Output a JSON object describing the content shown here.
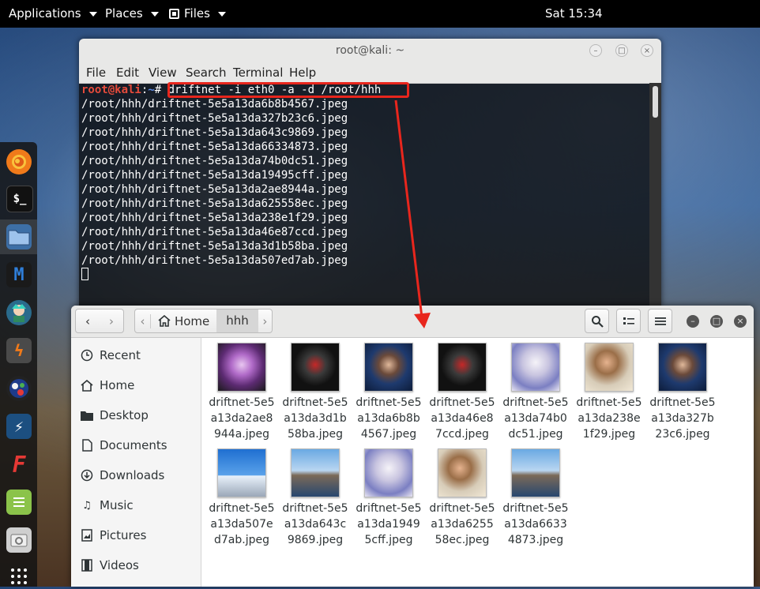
{
  "topbar": {
    "applications": "Applications",
    "places": "Places",
    "files": "Files",
    "clock": "Sat 15:34"
  },
  "terminal": {
    "title": "root@kali: ~",
    "menu": [
      "File",
      "Edit",
      "View",
      "Search",
      "Terminal",
      "Help"
    ],
    "prompt_user": "root@kali",
    "prompt_sep": ":",
    "prompt_path": "~",
    "prompt_symbol": "# ",
    "command": "driftnet -i eth0 -a -d /root/hhh",
    "output": [
      "/root/hhh/driftnet-5e5a13da6b8b4567.jpeg",
      "/root/hhh/driftnet-5e5a13da327b23c6.jpeg",
      "/root/hhh/driftnet-5e5a13da643c9869.jpeg",
      "/root/hhh/driftnet-5e5a13da66334873.jpeg",
      "/root/hhh/driftnet-5e5a13da74b0dc51.jpeg",
      "/root/hhh/driftnet-5e5a13da19495cff.jpeg",
      "/root/hhh/driftnet-5e5a13da2ae8944a.jpeg",
      "/root/hhh/driftnet-5e5a13da625558ec.jpeg",
      "/root/hhh/driftnet-5e5a13da238e1f29.jpeg",
      "/root/hhh/driftnet-5e5a13da46e87ccd.jpeg",
      "/root/hhh/driftnet-5e5a13da3d1b58ba.jpeg",
      "/root/hhh/driftnet-5e5a13da507ed7ab.jpeg"
    ]
  },
  "files": {
    "breadcrumb": {
      "home": "Home",
      "current": "hhh"
    },
    "sidebar": [
      "Recent",
      "Home",
      "Desktop",
      "Documents",
      "Downloads",
      "Music",
      "Pictures",
      "Videos"
    ],
    "items": [
      {
        "name": "driftnet-5e5a13da2ae8944a.jpeg",
        "thumb": "flower"
      },
      {
        "name": "driftnet-5e5a13da3d1b58ba.jpeg",
        "thumb": "christmas"
      },
      {
        "name": "driftnet-5e5a13da6b8b4567.jpeg",
        "thumb": "portrait"
      },
      {
        "name": "driftnet-5e5a13da46e87ccd.jpeg",
        "thumb": "christmas"
      },
      {
        "name": "driftnet-5e5a13da74b0dc51.jpeg",
        "thumb": "anime"
      },
      {
        "name": "driftnet-5e5a13da238e1f29.jpeg",
        "thumb": "child"
      },
      {
        "name": "driftnet-5e5a13da327b23c6.jpeg",
        "thumb": "portrait"
      },
      {
        "name": "driftnet-5e5a13da507ed7ab.jpeg",
        "thumb": "sky"
      },
      {
        "name": "driftnet-5e5a13da643c9869.jpeg",
        "thumb": "beach"
      },
      {
        "name": "driftnet-5e5a13da19495cff.jpeg",
        "thumb": "anime"
      },
      {
        "name": "driftnet-5e5a13da625558ec.jpeg",
        "thumb": "child"
      },
      {
        "name": "driftnet-5e5a13da66334873.jpeg",
        "thumb": "beach"
      }
    ]
  },
  "dock": [
    "firefox-icon",
    "terminal-icon",
    "files-icon",
    "metasploit-icon",
    "armitage-icon",
    "burpsuite-icon",
    "maltego-icon",
    "beef-icon",
    "faraday-icon",
    "leafpad-icon",
    "cutycapt-icon",
    "show-apps-icon"
  ],
  "colors": {
    "accent_red": "#e8261d",
    "prompt_red": "#e64b3b",
    "prompt_blue": "#5c8ae6"
  }
}
